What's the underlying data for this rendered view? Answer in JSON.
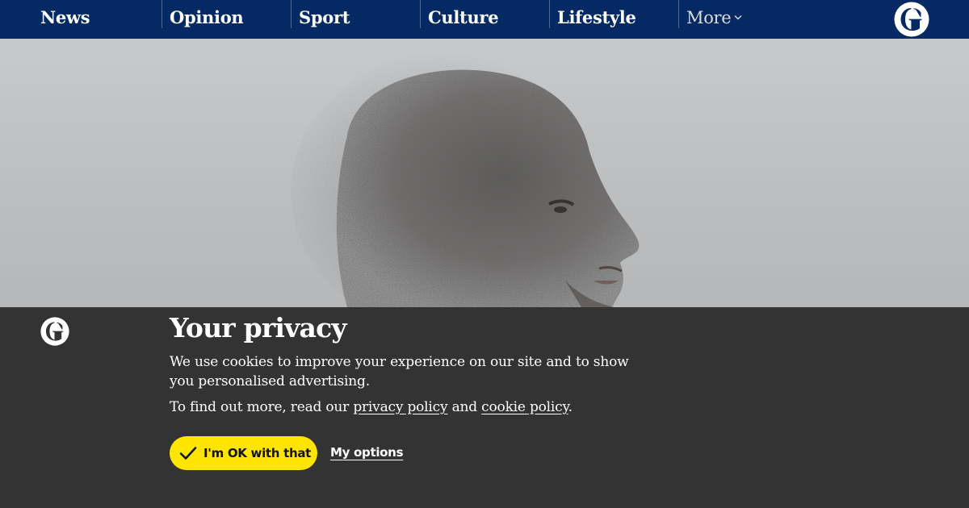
{
  "nav": {
    "items": [
      {
        "label": "News"
      },
      {
        "label": "Opinion"
      },
      {
        "label": "Sport"
      },
      {
        "label": "Culture"
      },
      {
        "label": "Lifestyle"
      }
    ],
    "more_label": "More",
    "logo_icon": "guardian-g-logo-icon",
    "colors": {
      "background": "#052962",
      "text": "#ffffff",
      "separator": "#506991"
    }
  },
  "hero": {
    "image": "grainy-profile-portrait-of-man"
  },
  "consent": {
    "title": "Your privacy",
    "body": "We use cookies to improve your experience on our site and to show you personalised advertising.",
    "more_prefix": "To find out more, read our",
    "privacy_link": "privacy policy",
    "conjunction": "and",
    "cookie_link": "cookie policy",
    "more_suffix": ".",
    "accept_label": "I'm OK with that",
    "options_label": "My options",
    "colors": {
      "background": "#333333",
      "accept_button": "#ffe500",
      "text": "#ffffff"
    }
  }
}
